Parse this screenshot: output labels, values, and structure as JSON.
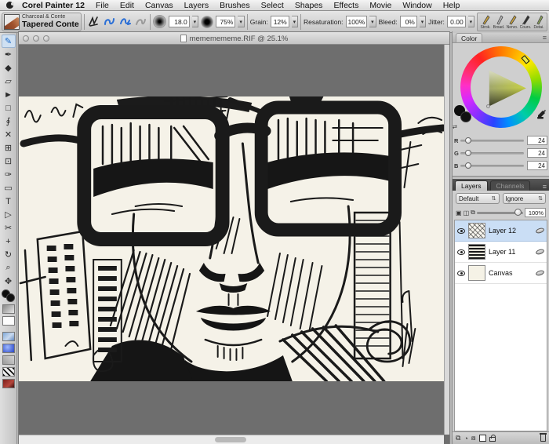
{
  "menu_bar": {
    "app_name": "Corel Painter 12",
    "items": [
      "File",
      "Edit",
      "Canvas",
      "Layers",
      "Brushes",
      "Select",
      "Shapes",
      "Effects",
      "Movie",
      "Window",
      "Help"
    ]
  },
  "property_bar": {
    "brush_category": "Charcoal & Conte",
    "brush_variant": "Tapered Conte",
    "size_value": "18.0",
    "opacity_value": "75%",
    "grain_label": "Grain:",
    "grain_value": "12%",
    "resat_label": "Resaturation:",
    "resat_value": "100%",
    "bleed_label": "Bleed:",
    "bleed_value": "0%",
    "jitter_label": "Jitter:",
    "jitter_value": "0.00",
    "dropdown_arrow": "▾",
    "shortcuts": [
      {
        "label": "Strok."
      },
      {
        "label": "Broad."
      },
      {
        "label": "Nervo."
      },
      {
        "label": "Cours."
      },
      {
        "label": "Detai."
      }
    ]
  },
  "document": {
    "title": "mememememe.RIF @ 25.1%"
  },
  "toolbox": {
    "tools": [
      {
        "name": "brush",
        "glyph": "✎"
      },
      {
        "name": "dropper",
        "glyph": "✒"
      },
      {
        "name": "paint-bucket",
        "glyph": "◆"
      },
      {
        "name": "eraser",
        "glyph": "▱"
      },
      {
        "name": "layer-adjuster",
        "glyph": "►"
      },
      {
        "name": "rect-select",
        "glyph": "□"
      },
      {
        "name": "lasso",
        "glyph": "∮"
      },
      {
        "name": "magic-wand",
        "glyph": "✕"
      },
      {
        "name": "crop",
        "glyph": "⊞"
      },
      {
        "name": "transform",
        "glyph": "⊡"
      },
      {
        "name": "pen",
        "glyph": "✑"
      },
      {
        "name": "rect-shape",
        "glyph": "▭"
      },
      {
        "name": "text",
        "glyph": "T"
      },
      {
        "name": "shape-select",
        "glyph": "▷"
      },
      {
        "name": "scissors",
        "glyph": "✂"
      },
      {
        "name": "add-point",
        "glyph": "+"
      },
      {
        "name": "rotate-page",
        "glyph": "↻"
      },
      {
        "name": "magnifier",
        "glyph": "⌕"
      },
      {
        "name": "grabber",
        "glyph": "✥"
      }
    ]
  },
  "color_panel": {
    "tab": "Color",
    "menu_glyph": "≡",
    "channels": [
      {
        "label": "R",
        "value": "24"
      },
      {
        "label": "G",
        "value": "24"
      },
      {
        "label": "B",
        "value": "24"
      }
    ],
    "swap_glyph": "⇄"
  },
  "layers_panel": {
    "tab_layers": "Layers",
    "tab_channels": "Channels",
    "menu_glyph": "≡",
    "composite_method": "Default",
    "composite_depth": "Ignore",
    "combo_arrow": "⇅",
    "opacity_value": "100%",
    "layers": [
      {
        "name": "Layer 12"
      },
      {
        "name": "Layer 11"
      },
      {
        "name": "Canvas"
      }
    ]
  }
}
